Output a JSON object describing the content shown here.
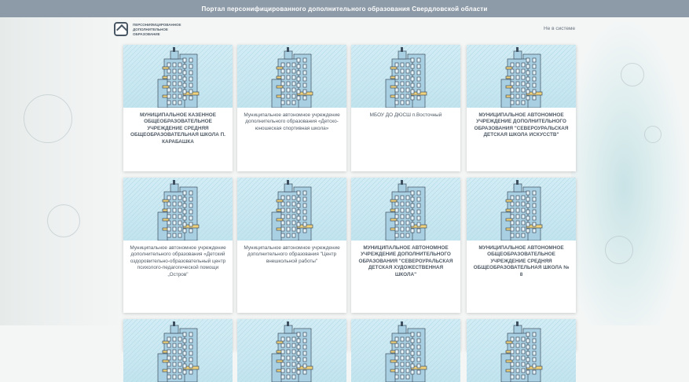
{
  "top_bar": {
    "title": "Портал персонифицированного дополнительного образования Свердловской области"
  },
  "header": {
    "logo_lines": [
      "ПЕРСОНИФИЦИРОВАННОЕ",
      "ДОПОЛНИТЕЛЬНОЕ",
      "ОБРАЗОВАНИЕ"
    ],
    "login_label": "Не в системе"
  },
  "cards": [
    {
      "title": "МУНИЦИПАЛЬНОЕ КАЗЕННОЕ ОБЩЕОБРАЗОВАТЕЛЬНОЕ УЧРЕЖДЕНИЕ СРЕДНЯЯ ОБЩЕОБРАЗОВАТЕЛЬНАЯ ШКОЛА П. КАРАБАШКА"
    },
    {
      "title": "Муниципальное автономное учреждение дополнительного образования «Детско-юношеская спортивная школа»"
    },
    {
      "title": "МБОУ ДО ДЮСШ п.Восточный"
    },
    {
      "title": "МУНИЦИПАЛЬНОЕ АВТОНОМНОЕ УЧРЕЖДЕНИЕ ДОПОЛНИТЕЛЬНОГО ОБРАЗОВАНИЯ \"СЕВЕРОУРАЛЬСКАЯ ДЕТСКАЯ ШКОЛА ИСКУССТВ\""
    },
    {
      "title": "Муниципальное автономное учреждение дополнительного образования «Детский оздоровительно-образовательный центр психолого-педагогической помощи „Остров\""
    },
    {
      "title": "Муниципальное автономное учреждение дополнительного образования \"Центр внешкольной работы\""
    },
    {
      "title": "МУНИЦИПАЛЬНОЕ АВТОНОМНОЕ УЧРЕЖДЕНИЕ ДОПОЛНИТЕЛЬНОГО ОБРАЗОВАНИЯ \"СЕВЕРОУРАЛЬСКАЯ ДЕТСКАЯ ХУДОЖЕСТВЕННАЯ ШКОЛА\""
    },
    {
      "title": "МУНИЦИПАЛЬНОЕ АВТОНОМНОЕ ОБЩЕОБРАЗОВАТЕЛЬНОЕ УЧРЕЖДЕНИЕ СРЕДНЯЯ ОБЩЕОБРАЗОВАТЕЛЬНАЯ ШКОЛА № 8"
    }
  ],
  "colors": {
    "top_bar": "#8d9aa7",
    "card_image_bg": "#c2e4ef",
    "building_blue": "#a9cfe3",
    "building_yellow": "#f1d27a",
    "building_outline": "#3e4f5f",
    "card_text": "#4f5a66"
  }
}
